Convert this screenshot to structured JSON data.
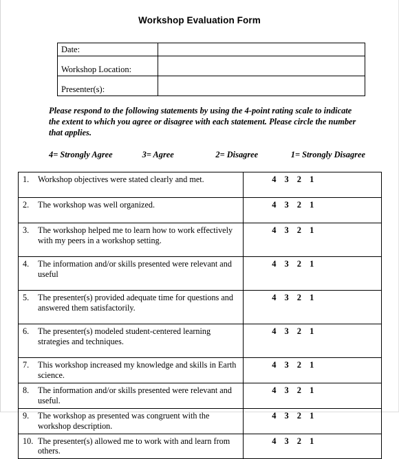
{
  "document": {
    "title": "Workshop Evaluation Form"
  },
  "info_table": {
    "rows": [
      {
        "label": "Date:",
        "value": ""
      },
      {
        "label": "Workshop Location:",
        "value": ""
      },
      {
        "label": "Presenter(s):",
        "value": ""
      }
    ]
  },
  "instructions": {
    "text": "Please respond to the following statements by using the 4-point rating scale to indicate the extent to which you agree or disagree with each statement.  Please circle the number that applies."
  },
  "scale_legend": {
    "items": [
      "4= Strongly Agree",
      "3= Agree",
      "2= Disagree",
      "1= Strongly Disagree"
    ]
  },
  "statements": {
    "rating_options": "4  3  2  1",
    "items": [
      {
        "number": "1.",
        "text": "Workshop objectives were stated clearly and met.",
        "rating": "4  3  2  1"
      },
      {
        "number": "2.",
        "text": "The workshop was well organized.",
        "rating": "4  3  2  1"
      },
      {
        "number": "3.",
        "text": "The workshop helped me to learn how to work effectively with my peers in a workshop setting.",
        "rating": "4  3  2  1"
      },
      {
        "number": "4.",
        "text": "The information and/or skills presented were relevant and useful",
        "rating": "4  3  2  1"
      },
      {
        "number": "5.",
        "text": "The presenter(s) provided adequate time for questions and answered them satisfactorily.",
        "rating": "4  3  2  1"
      },
      {
        "number": "6.",
        "text": "The presenter(s) modeled student-centered learning strategies and techniques.",
        "rating": "4  3  2  1"
      },
      {
        "number": "7.",
        "text": "This workshop increased my knowledge and skills in Earth science.",
        "rating": "4  3  2  1"
      },
      {
        "number": "8.",
        "text": "The information and/or skills presented were relevant and useful.",
        "rating": "4  3  2  1"
      },
      {
        "number": "9.",
        "text": "The workshop as presented was congruent with the workshop description.",
        "rating": "4  3  2  1"
      },
      {
        "number": "10.",
        "text": "The presenter(s) allowed me to work with and learn from others.",
        "rating": "4  3  2  1"
      }
    ]
  }
}
